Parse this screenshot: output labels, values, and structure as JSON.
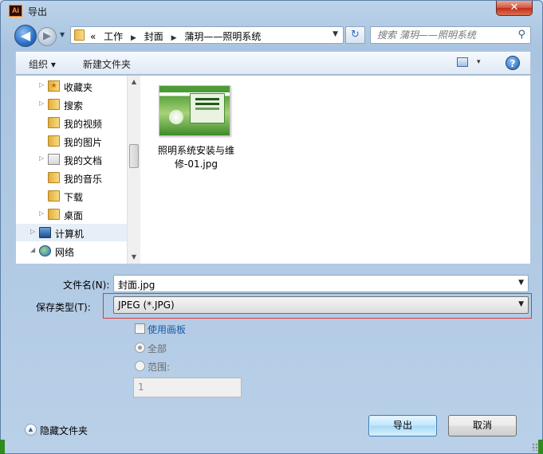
{
  "window": {
    "title": "导出",
    "app_icon_text": "Ai",
    "close_symbol": "✕"
  },
  "nav": {
    "back_symbol": "◀",
    "forward_symbol": "▶",
    "breadcrumbs": [
      "«",
      "工作",
      "封面",
      "蒲玥——照明系统"
    ],
    "search_placeholder": "搜索 蒲玥——照明系统",
    "refresh_symbol": "↻",
    "search_symbol": "⚲"
  },
  "toolbar": {
    "organize_label": "组织 ▾",
    "new_folder_label": "新建文件夹",
    "view_drop": "▾",
    "help_symbol": "?"
  },
  "sidebar": {
    "items": [
      {
        "label": "收藏夹",
        "icon": "star-folder-icon",
        "expand": "▷"
      },
      {
        "label": "搜索",
        "icon": "search-folder-icon",
        "expand": "▷"
      },
      {
        "label": "我的视频",
        "icon": "folder-icon",
        "expand": ""
      },
      {
        "label": "我的图片",
        "icon": "folder-icon",
        "expand": ""
      },
      {
        "label": "我的文档",
        "icon": "document-icon",
        "expand": "▷"
      },
      {
        "label": "我的音乐",
        "icon": "folder-icon",
        "expand": ""
      },
      {
        "label": "下载",
        "icon": "folder-icon",
        "expand": ""
      },
      {
        "label": "桌面",
        "icon": "folder-icon",
        "expand": "▷"
      },
      {
        "label": "计算机",
        "icon": "computer-icon",
        "expand": "▷"
      },
      {
        "label": "网络",
        "icon": "network-icon",
        "expand": "◢"
      }
    ],
    "scroll_up": "▲",
    "scroll_down": "▼"
  },
  "files": [
    {
      "name": "照明系统安装与维修-01.jpg"
    }
  ],
  "form": {
    "filename_label": "文件名(N):",
    "filename_value": "封面.jpg",
    "type_label": "保存类型(T):",
    "type_value": "JPEG (*.JPG)",
    "use_artboard_label": "使用画板",
    "all_label": "全部",
    "range_label": "范围:",
    "range_value": "1"
  },
  "footer": {
    "hide_folders_label": "隐藏文件夹",
    "hide_symbol": "▲",
    "export_label": "导出",
    "cancel_label": "取消"
  },
  "colors": {
    "highlight_border": "#d93b3b",
    "accent_blue": "#1a5aa6"
  }
}
